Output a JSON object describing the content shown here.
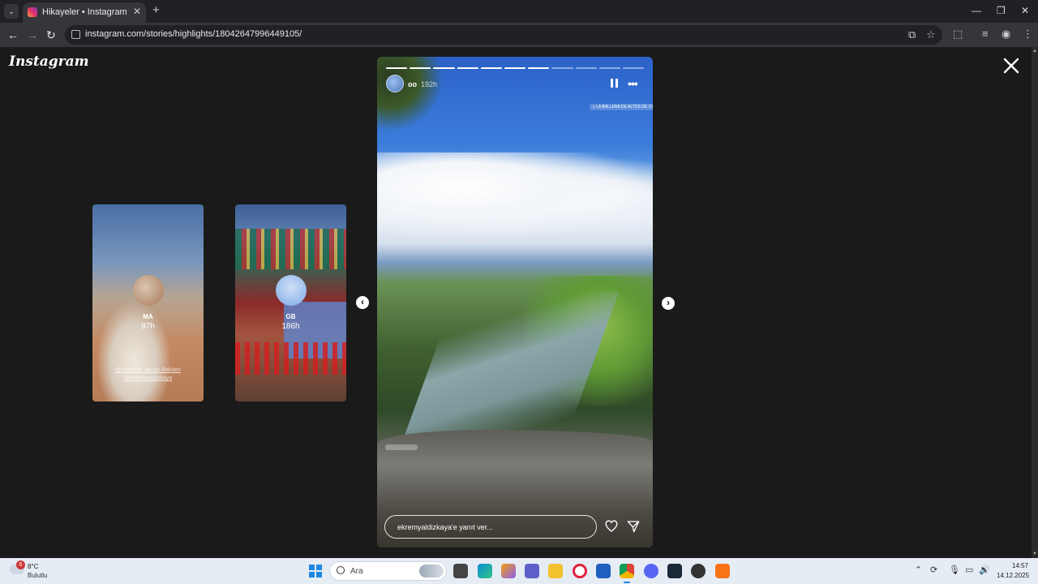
{
  "browser": {
    "tab_title": "Hikayeler • Instagram",
    "url": "instagram.com/stories/highlights/18042647996449105/"
  },
  "page": {
    "logo": "Instagram"
  },
  "side_stories": [
    {
      "username": "MA",
      "time": "97h",
      "caption": "@mehmet_akcan Reklam @ekremyaldizkaya"
    },
    {
      "username": "GB",
      "time": "186h"
    }
  ],
  "main_story": {
    "username": "oo",
    "time": "192h",
    "progress_total": 11,
    "progress_done": 7,
    "music_sticker": "♫ LA BALLENA DE ALTOS DE CHAVÓN",
    "reply_placeholder": "ekremyaldizkaya'e yanıt ver..."
  },
  "taskbar": {
    "weather_temp": "8°C",
    "weather_desc": "Bulutlu",
    "weather_badge": "6",
    "search_placeholder": "Ara",
    "time": "14:57",
    "date": "14.12.2025"
  },
  "icons": {
    "accent": "#1e88e5"
  }
}
